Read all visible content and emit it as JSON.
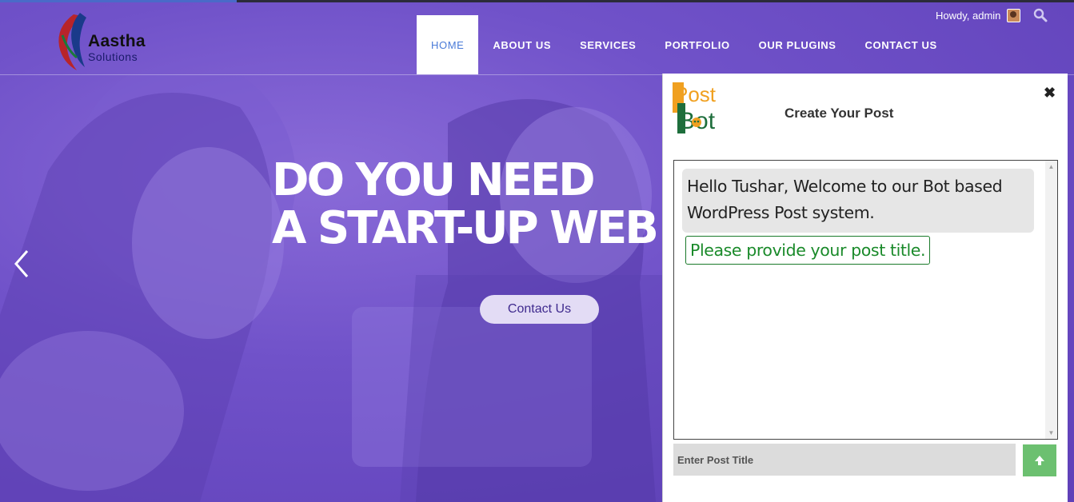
{
  "header": {
    "logo_name": "Aastha",
    "logo_sub": "Solutions",
    "nav": [
      {
        "label": "HOME",
        "active": true
      },
      {
        "label": "ABOUT US",
        "active": false
      },
      {
        "label": "SERVICES",
        "active": false
      },
      {
        "label": "PORTFOLIO",
        "active": false
      },
      {
        "label": "OUR PLUGINS",
        "active": false
      },
      {
        "label": "CONTACT US",
        "active": false
      }
    ],
    "howdy": "Howdy, admin",
    "icons": {
      "search": "search-icon",
      "avatar": "user-avatar"
    }
  },
  "hero": {
    "headline_line1": "DO YOU NEED",
    "headline_line2": "A START-UP WEB",
    "button": "Contact Us",
    "prev_icon": "chevron-left-icon"
  },
  "postbot": {
    "logo_line1": "Post",
    "logo_line2": "Bot",
    "title": "Create Your Post",
    "close_icon": "close-icon",
    "bot_message": "Hello Tushar, Welcome to our Bot based WordPress Post system.",
    "prompt": "Please provide your post title.",
    "input_placeholder": "Enter Post Title",
    "send_icon": "arrow-up-icon"
  },
  "colors": {
    "hero_purple": "#6a4bc4",
    "nav_active_text": "#4a7bd8",
    "prompt_green": "#1a8a2a",
    "send_green": "#6cc070",
    "logo_orange": "#f0a020"
  }
}
